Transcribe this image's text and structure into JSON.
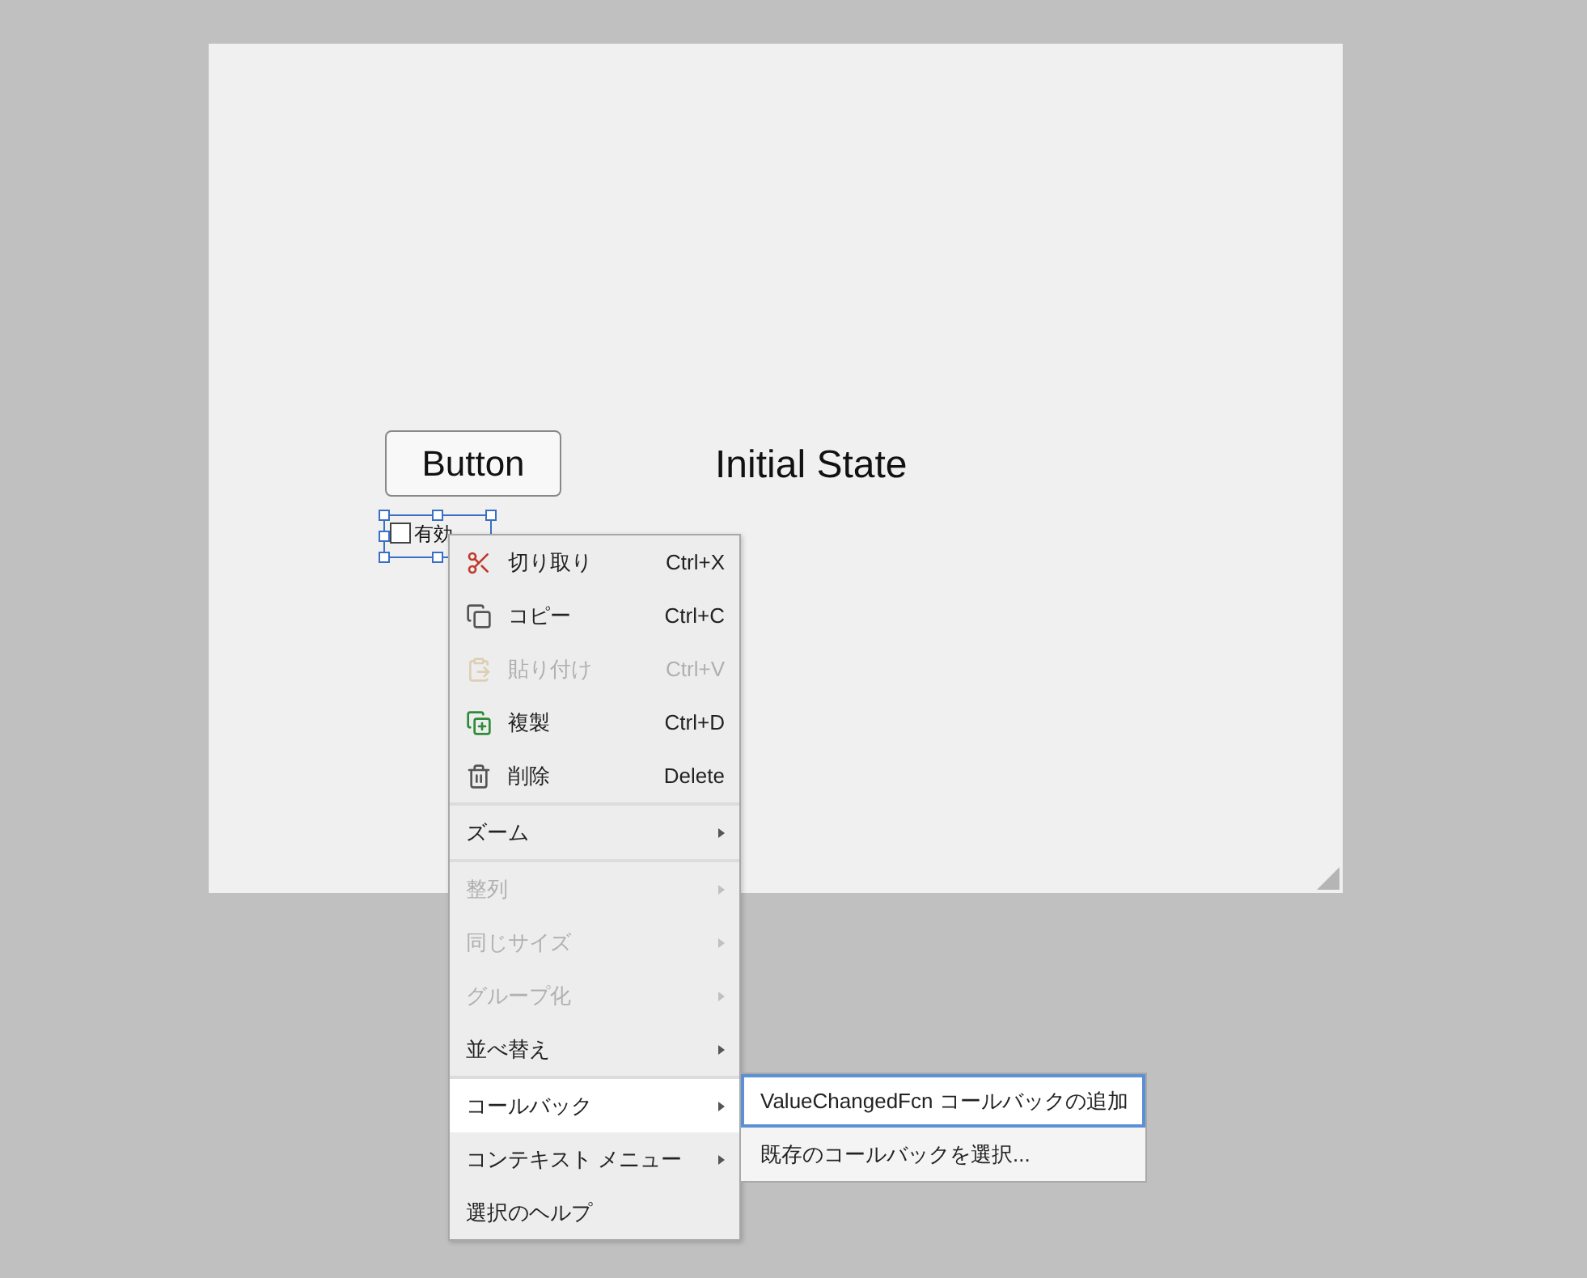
{
  "canvas": {
    "button": {
      "label": "Button"
    },
    "label": {
      "text": "Initial State"
    },
    "checkbox": {
      "label": "有効",
      "checked": false,
      "selected": true
    }
  },
  "context_menu": {
    "groups": [
      [
        {
          "kind": "command",
          "label": "切り取り",
          "shortcut": "Ctrl+X",
          "disabled": false,
          "selected": false
        },
        {
          "kind": "command",
          "label": "コピー",
          "shortcut": "Ctrl+C",
          "disabled": false,
          "selected": false
        },
        {
          "kind": "command",
          "label": "貼り付け",
          "shortcut": "Ctrl+V",
          "disabled": true,
          "selected": false
        },
        {
          "kind": "command",
          "label": "複製",
          "shortcut": "Ctrl+D",
          "disabled": false,
          "selected": false
        },
        {
          "kind": "command",
          "label": "削除",
          "shortcut": "Delete",
          "disabled": false,
          "selected": false
        }
      ],
      [
        {
          "kind": "submenu",
          "label": "ズーム",
          "disabled": false,
          "selected": false
        }
      ],
      [
        {
          "kind": "submenu",
          "label": "整列",
          "disabled": true,
          "selected": false
        },
        {
          "kind": "submenu",
          "label": "同じサイズ",
          "disabled": true,
          "selected": false
        },
        {
          "kind": "submenu",
          "label": "グループ化",
          "disabled": true,
          "selected": false
        },
        {
          "kind": "submenu",
          "label": "並べ替え",
          "disabled": false,
          "selected": false
        }
      ],
      [
        {
          "kind": "submenu",
          "label": "コールバック",
          "disabled": false,
          "selected": true
        },
        {
          "kind": "submenu",
          "label": "コンテキスト メニュー",
          "disabled": false,
          "selected": false
        },
        {
          "kind": "plain",
          "label": "選択のヘルプ",
          "disabled": false,
          "selected": false
        }
      ]
    ],
    "submenu": [
      {
        "label": "ValueChangedFcn コールバックの追加",
        "selected": true
      },
      {
        "label": "既存のコールバックを選択...",
        "selected": false
      }
    ]
  }
}
